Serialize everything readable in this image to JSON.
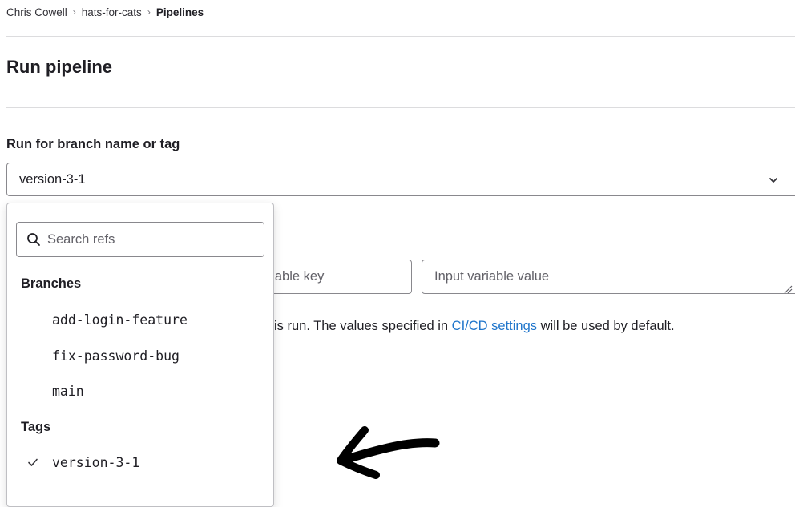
{
  "breadcrumb": {
    "items": [
      "Chris Cowell",
      "hats-for-cats",
      "Pipelines"
    ]
  },
  "page": {
    "title": "Run pipeline"
  },
  "ref_field": {
    "label": "Run for branch name or tag",
    "selected": "version-3-1",
    "icon": "chevron-down-icon"
  },
  "variables": {
    "key_placeholder": "Input variable key",
    "value_placeholder": "Input variable value",
    "help_prefix": "is run. The values specified in ",
    "help_link": "CI/CD settings",
    "help_suffix": " will be used by default."
  },
  "dropdown": {
    "search_placeholder": "Search refs",
    "branches_header": "Branches",
    "branches": [
      "add-login-feature",
      "fix-password-bug",
      "main"
    ],
    "tags_header": "Tags",
    "tags": [
      "version-3-1"
    ],
    "selected_tag": "version-3-1"
  },
  "colors": {
    "link": "#1f75cb",
    "border": "#89888d",
    "text": "#1f1e24",
    "annotation": "#000000"
  }
}
